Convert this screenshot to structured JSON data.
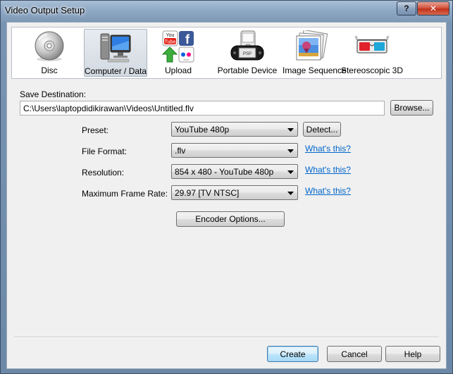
{
  "window": {
    "title": "Video Output Setup",
    "help_glyph": "?",
    "close_glyph": "✕"
  },
  "tabs": [
    {
      "label": "Disc",
      "icon": "disc-icon",
      "active": false
    },
    {
      "label": "Computer / Data",
      "icon": "computer-icon",
      "active": true
    },
    {
      "label": "Upload",
      "icon": "upload-icon",
      "active": false
    },
    {
      "label": "Portable Device",
      "icon": "portable-device-icon",
      "active": false
    },
    {
      "label": "Image Sequence",
      "icon": "image-sequence-icon",
      "active": false
    },
    {
      "label": "Stereoscopic 3D",
      "icon": "3d-glasses-icon",
      "active": false
    }
  ],
  "upload_icon_text": {
    "youtube_top": "You",
    "youtube_bottom": "Tube",
    "facebook": "f",
    "flickr": "flickr"
  },
  "portable_icon_text": {
    "psp": "PSP"
  },
  "save": {
    "label": "Save Destination:",
    "path": "C:\\Users\\laptopdidikirawan\\Videos\\Untitled.flv",
    "browse_label": "Browse..."
  },
  "fields": {
    "preset": {
      "label": "Preset:",
      "value": "YouTube 480p",
      "action_label": "Detect..."
    },
    "format": {
      "label": "File Format:",
      "value": ".flv",
      "link": "What's this?"
    },
    "resolution": {
      "label": "Resolution:",
      "value": "854 x 480 - YouTube 480p",
      "link": "What's this?"
    },
    "framerate": {
      "label": "Maximum Frame Rate:",
      "value": "29.97 [TV NTSC]",
      "link": "What's this?"
    }
  },
  "encoder_label": "Encoder Options...",
  "footer": {
    "create_label": "Create",
    "cancel_label": "Cancel",
    "help_label": "Help"
  },
  "colors": {
    "link": "#0066cc",
    "titlebar": "#8fa9c5",
    "close": "#c0321b",
    "youtube_red": "#e62117",
    "facebook_blue": "#3b5998"
  }
}
